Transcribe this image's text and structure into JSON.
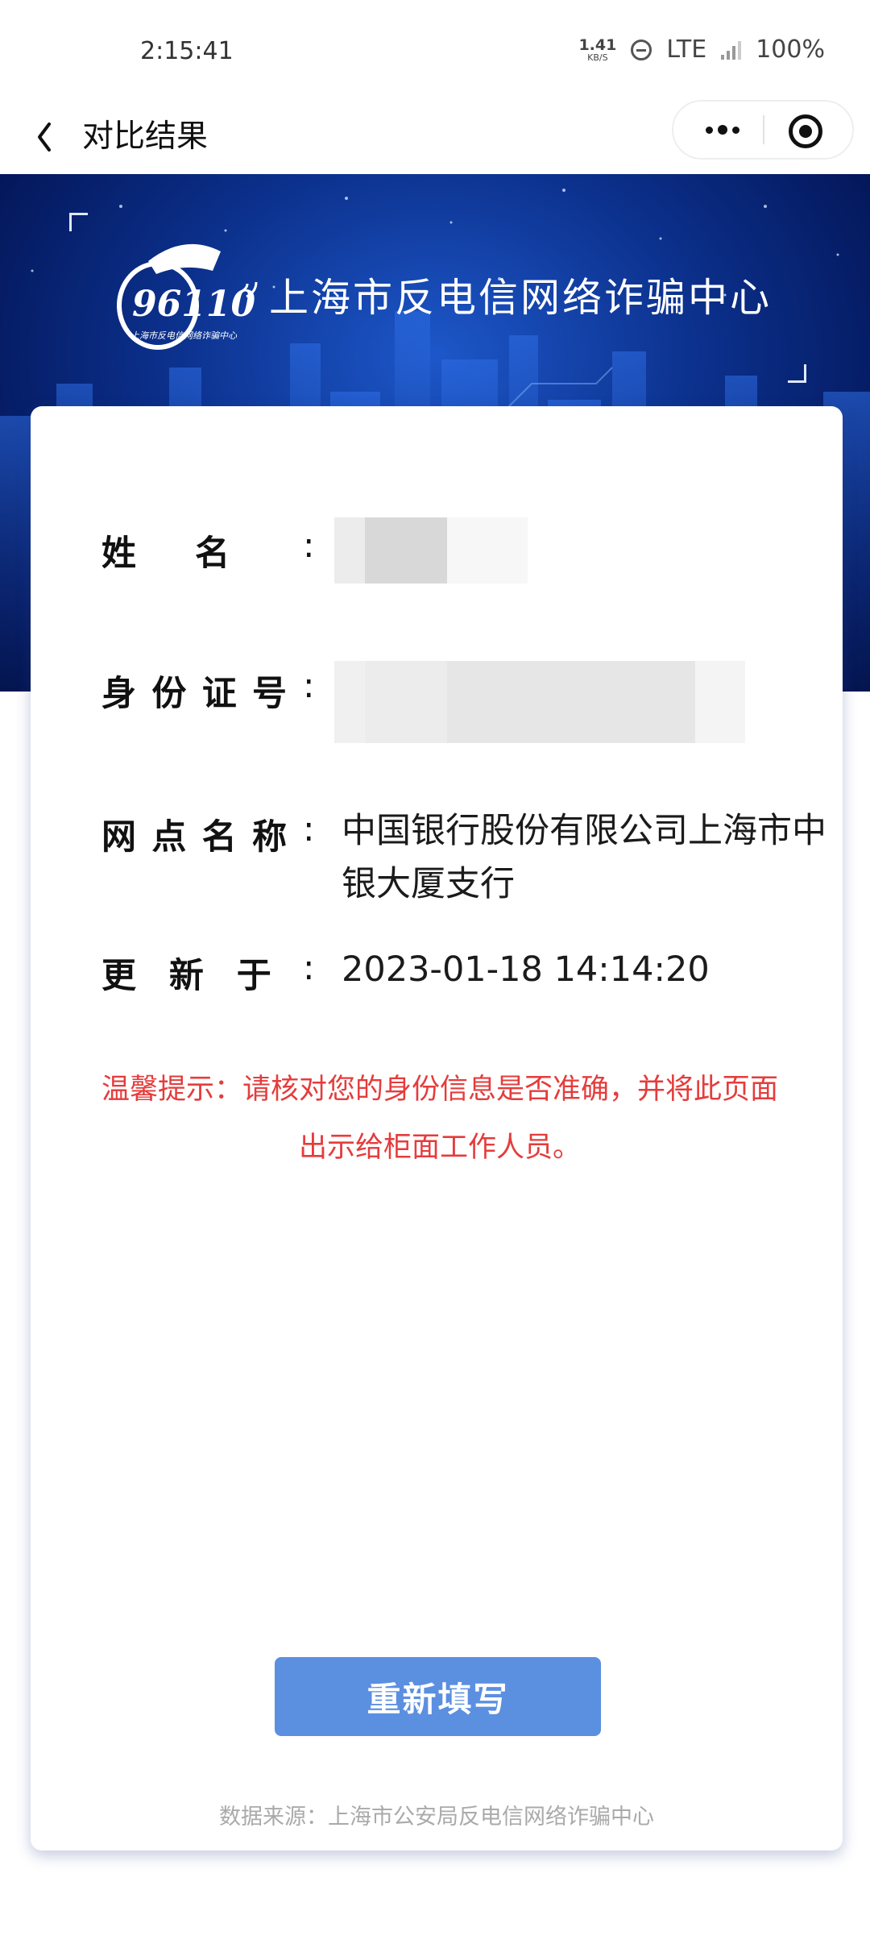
{
  "status_bar": {
    "time": "2:15:41",
    "net_speed_value": "1.41",
    "net_speed_unit": "KB/S",
    "network": "LTE",
    "battery": "100%"
  },
  "nav": {
    "title": "对比结果"
  },
  "banner": {
    "logo_number": "96110",
    "logo_caption": "上海市反电信网络诈骗中心",
    "title": "上海市反电信网络诈骗中心"
  },
  "result": {
    "name_label": "姓名",
    "id_label": "身份证号",
    "branch_label": "网点名称",
    "branch_value": "中国银行股份有限公司上海市中银大厦支行",
    "updated_label": "更新于",
    "updated_value": "2023-01-18 14:14:20",
    "colon": ":"
  },
  "hint": "温馨提示：请核对您的身份信息是否准确，并将此页面出示给柜面工作人员。",
  "refill_button": "重新填写",
  "source": "数据来源：上海市公安局反电信网络诈骗中心",
  "colors": {
    "banner_dark": "#04175a",
    "banner_bright": "#1d57c9",
    "hint_red": "#e53c3c",
    "button_blue": "#5b8fe0"
  }
}
